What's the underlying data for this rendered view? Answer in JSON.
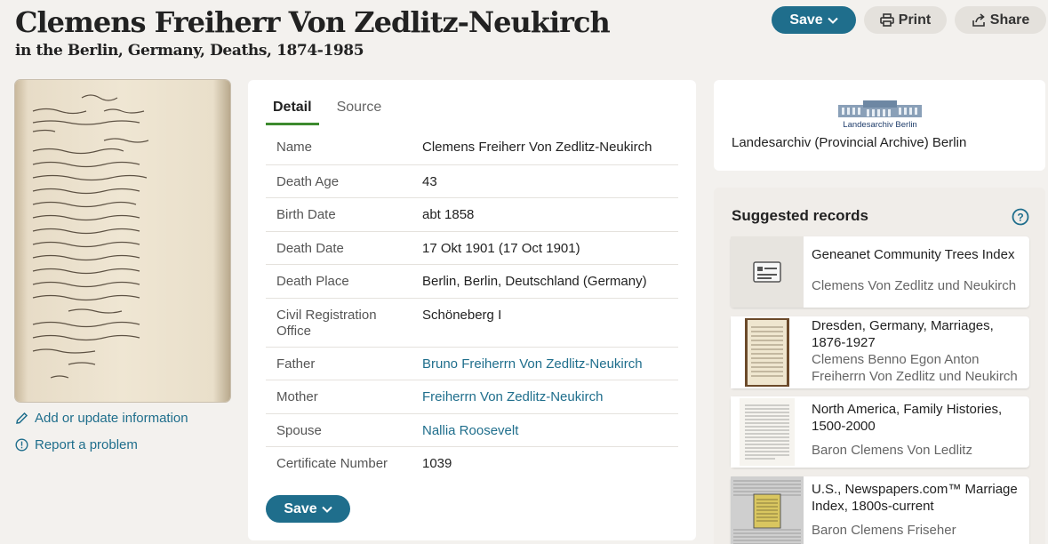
{
  "header": {
    "title": "Clemens Freiherr Von Zedlitz-Neukirch",
    "subtitle": "in the Berlin, Germany, Deaths, 1874-1985"
  },
  "toolbar": {
    "save_label": "Save",
    "print_label": "Print",
    "share_label": "Share"
  },
  "side_links": {
    "edit": "Add or update information",
    "report": "Report a problem"
  },
  "tabs": [
    {
      "label": "Detail",
      "active": true
    },
    {
      "label": "Source",
      "active": false
    }
  ],
  "details": [
    {
      "key": "Name",
      "value": "Clemens Freiherr Von Zedlitz-Neukirch",
      "link": false
    },
    {
      "key": "Death Age",
      "value": "43",
      "link": false
    },
    {
      "key": "Birth Date",
      "value": "abt 1858",
      "link": false
    },
    {
      "key": "Death Date",
      "value": "17 Okt 1901 (17 Oct 1901)",
      "link": false
    },
    {
      "key": "Death Place",
      "value": "Berlin, Berlin, Deutschland (Germany)",
      "link": false
    },
    {
      "key": "Civil Registration Office",
      "value": "Schöneberg I",
      "link": false
    },
    {
      "key": "Father",
      "value": "Bruno Freiherrn Von Zedlitz-Neukirch",
      "link": true
    },
    {
      "key": "Mother",
      "value": "Freiherrn Von Zedlitz-Neukirch",
      "link": true
    },
    {
      "key": "Spouse",
      "value": "Nallia Roosevelt",
      "link": true
    },
    {
      "key": "Certificate Number",
      "value": "1039",
      "link": false
    }
  ],
  "bottom_save_label": "Save",
  "archive": {
    "logo_text": "Landesarchiv Berlin",
    "name": "Landesarchiv (Provincial Archive) Berlin"
  },
  "suggested": {
    "title": "Suggested records",
    "items": [
      {
        "title": "Geneanet Community Trees Index",
        "subtitle": "Clemens Von Zedlitz und Neukirch",
        "thumb": "index-card-icon"
      },
      {
        "title": "Dresden, Germany, Marriages, 1876-1927",
        "subtitle": "Clemens Benno Egon Anton Freiherrn Von Zedlitz und Neukirch",
        "thumb": "book-page"
      },
      {
        "title": "North America, Family Histories, 1500-2000",
        "subtitle": "Baron Clemens Von Ledlitz",
        "thumb": "printed-page"
      },
      {
        "title": "U.S., Newspapers.com™ Marriage Index, 1800s-current",
        "subtitle": "Baron Clemens Friseher",
        "thumb": "newspaper-clipping"
      }
    ]
  },
  "colors": {
    "accent": "#1f6e8c",
    "tab_underline": "#3c8a2e",
    "background": "#f3f1ee",
    "secondary_button": "#e4e1dc"
  }
}
